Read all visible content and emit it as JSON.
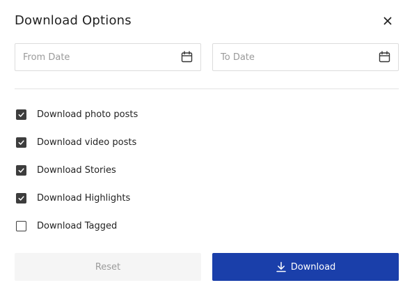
{
  "dialog": {
    "title": "Download Options",
    "close_icon": "close-icon"
  },
  "dates": {
    "from": {
      "placeholder": "From Date",
      "value": "",
      "icon": "calendar-icon"
    },
    "to": {
      "placeholder": "To Date",
      "value": "",
      "icon": "calendar-icon"
    }
  },
  "options": [
    {
      "label": "Download photo posts",
      "checked": true
    },
    {
      "label": "Download video posts",
      "checked": true
    },
    {
      "label": "Download Stories",
      "checked": true
    },
    {
      "label": "Download Highlights",
      "checked": true
    },
    {
      "label": "Download Tagged",
      "checked": false
    }
  ],
  "buttons": {
    "reset_label": "Reset",
    "download_label": "Download",
    "download_icon": "download-icon"
  },
  "colors": {
    "primary": "#1a3faa",
    "checkbox": "#3d3d3d",
    "reset_bg": "#f5f5f5",
    "reset_text": "#9b9b9b"
  }
}
